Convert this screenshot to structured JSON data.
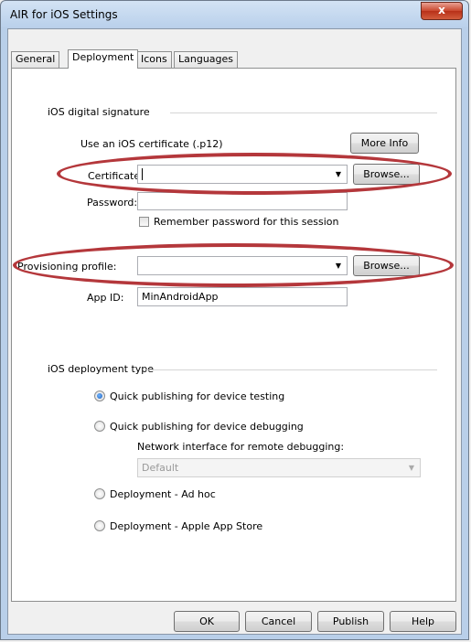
{
  "window": {
    "title": "AIR for iOS Settings",
    "close_glyph": "x"
  },
  "tabs": [
    {
      "label": "General",
      "active": false
    },
    {
      "label": "Deployment",
      "active": true
    },
    {
      "label": "Icons",
      "active": false
    },
    {
      "label": "Languages",
      "active": false
    }
  ],
  "signature": {
    "group_label": "iOS digital signature",
    "use_cert_label": "Use an iOS certificate (.p12)",
    "more_info": "More Info",
    "certificate_label": "Certificate:",
    "certificate_value": "",
    "browse": "Browse...",
    "password_label": "Password:",
    "password_value": "",
    "remember_label": "Remember password for this session",
    "provisioning_label": "Provisioning profile:",
    "provisioning_value": "",
    "appid_label": "App ID:",
    "appid_value": "MinAndroidApp"
  },
  "deployment": {
    "group_label": "iOS deployment type",
    "options": [
      {
        "label": "Quick publishing for device testing",
        "checked": true
      },
      {
        "label": "Quick publishing for device debugging",
        "checked": false
      },
      {
        "label": "Deployment - Ad hoc",
        "checked": false
      },
      {
        "label": "Deployment - Apple App Store",
        "checked": false
      }
    ],
    "network_label": "Network interface for remote debugging:",
    "network_value": "Default"
  },
  "footer": {
    "ok": "OK",
    "cancel": "Cancel",
    "publish": "Publish",
    "help": "Help"
  },
  "colors": {
    "highlight_oval": "#b4373b",
    "radio_selected": "#1e5fb8"
  }
}
